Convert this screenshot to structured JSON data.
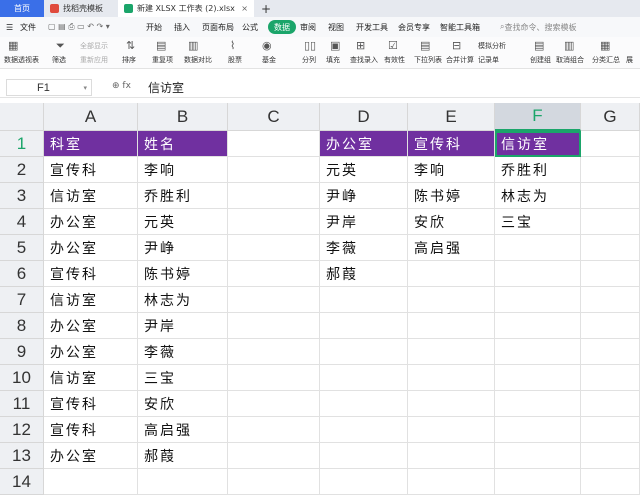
{
  "tabs": {
    "home": "首页",
    "template": "找稻壳模板",
    "file": "新建 XLSX 工作表 (2).xlsx",
    "close": "×",
    "new": "+"
  },
  "menu": {
    "file": "文件",
    "items": [
      "开始",
      "插入",
      "页面布局",
      "公式",
      "数据",
      "审阅",
      "视图",
      "开发工具",
      "会员专享",
      "智能工具箱"
    ],
    "active": "数据",
    "search": "查找命令、搜索模板"
  },
  "ribbon": {
    "pivot": "数据透视表",
    "filter": "筛选",
    "show_all": "全部显示",
    "reapply": "重新应用",
    "sort": "排序",
    "duplicates": "重复项",
    "compare": "数据对比",
    "stock": "股票",
    "fund": "基金",
    "split": "分列",
    "fill": "填充",
    "lookup": "查找录入",
    "validity": "有效性",
    "dropdown": "下拉列表",
    "merge": "合并计算",
    "simulate": "模拟分析",
    "record": "记录单",
    "create_group": "创建组",
    "ungroup": "取消组合",
    "subtotal": "分类汇总",
    "expand": "展"
  },
  "formula_bar": {
    "cell_ref": "F1",
    "fx": "fx",
    "value": "信访室"
  },
  "columns": [
    "A",
    "B",
    "C",
    "D",
    "E",
    "F",
    "G"
  ],
  "selected_column": "F",
  "rows": [
    "1",
    "2",
    "3",
    "4",
    "5",
    "6",
    "7",
    "8",
    "9",
    "10",
    "11",
    "12",
    "13",
    "14"
  ],
  "selected_row": "1",
  "cells": {
    "A": [
      "科室",
      "宣传科",
      "信访室",
      "办公室",
      "办公室",
      "宣传科",
      "信访室",
      "办公室",
      "办公室",
      "信访室",
      "宣传科",
      "宣传科",
      "办公室",
      ""
    ],
    "B": [
      "姓名",
      "李响",
      "乔胜利",
      "元英",
      "尹峥",
      "陈书婷",
      "林志为",
      "尹岸",
      "李薇",
      "三宝",
      "安欣",
      "高启强",
      "郝葭",
      ""
    ],
    "D": [
      "办公室",
      "元英",
      "尹峥",
      "尹岸",
      "李薇",
      "郝葭",
      "",
      "",
      "",
      "",
      "",
      "",
      "",
      ""
    ],
    "E": [
      "宣传科",
      "李响",
      "陈书婷",
      "安欣",
      "高启强",
      "",
      "",
      "",
      "",
      "",
      "",
      "",
      "",
      ""
    ],
    "F": [
      "信访室",
      "乔胜利",
      "林志为",
      "三宝",
      "",
      "",
      "",
      "",
      "",
      "",
      "",
      "",
      "",
      ""
    ]
  },
  "colors": {
    "header_fill": "#7030a0",
    "accent": "#1ba56a"
  }
}
